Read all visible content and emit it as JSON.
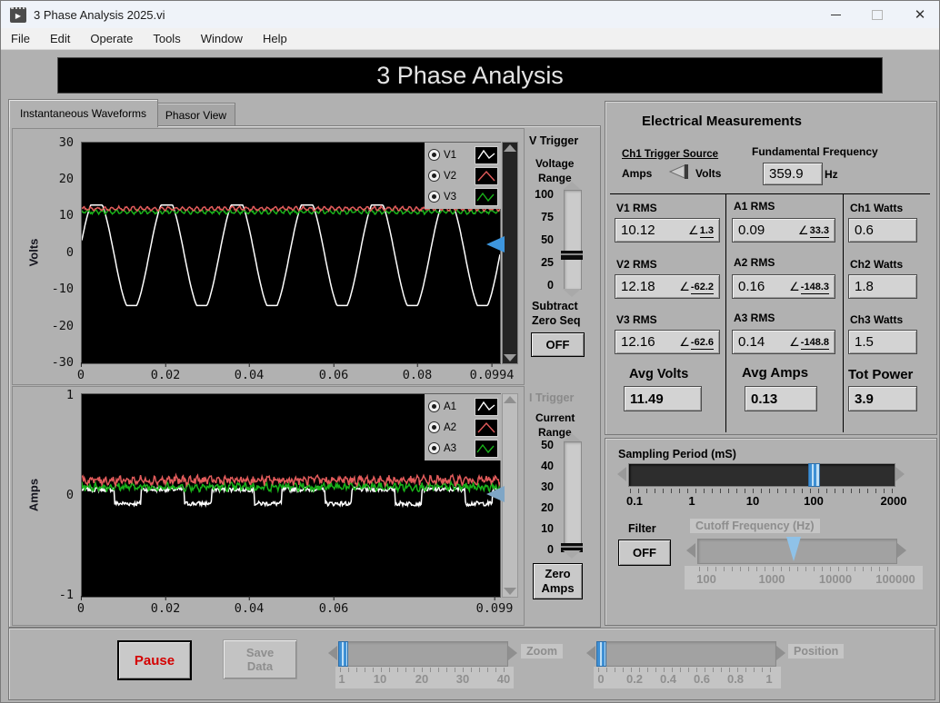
{
  "window": {
    "title": "3 Phase Analysis 2025.vi"
  },
  "menu": {
    "items": [
      "File",
      "Edit",
      "Operate",
      "Tools",
      "Window",
      "Help"
    ]
  },
  "banner": {
    "title": "3 Phase Analysis"
  },
  "tabs": [
    {
      "label": "Instantaneous Waveforms",
      "active": true
    },
    {
      "label": "Phasor View",
      "active": false
    }
  ],
  "v_trigger": {
    "title": "V Trigger",
    "range_line1": "Voltage",
    "range_line2": "Range",
    "ticks": [
      "100",
      "75",
      "50",
      "25",
      "0"
    ],
    "range_value": 30,
    "subtract_line1": "Subtract",
    "subtract_line2": "Zero Seq",
    "off_button": "OFF"
  },
  "i_trigger": {
    "title": "I Trigger",
    "range_line1": "Current",
    "range_line2": "Range",
    "ticks": [
      "50",
      "40",
      "30",
      "20",
      "10",
      "0"
    ],
    "range_value": 0,
    "zero_line1": "Zero",
    "zero_line2": "Amps"
  },
  "measurements": {
    "title": "Electrical Measurements",
    "angle_symbol": "∠",
    "trigger_source": {
      "label": "Ch1 Trigger Source",
      "left": "Amps",
      "right": "Volts"
    },
    "fundamental": {
      "label": "Fundamental Frequency",
      "value": "359.9",
      "unit": "Hz"
    },
    "volts": {
      "rows": [
        {
          "label": "V1 RMS",
          "value": "10.12",
          "angle": "1.3"
        },
        {
          "label": "V2 RMS",
          "value": "12.18",
          "angle": "-62.2"
        },
        {
          "label": "V3 RMS",
          "value": "12.16",
          "angle": "-62.6"
        }
      ],
      "avg_label": "Avg Volts",
      "avg_value": "11.49"
    },
    "amps": {
      "rows": [
        {
          "label": "A1 RMS",
          "value": "0.09",
          "angle": "33.3"
        },
        {
          "label": "A2 RMS",
          "value": "0.16",
          "angle": "-148.3"
        },
        {
          "label": "A3 RMS",
          "value": "0.14",
          "angle": "-148.8"
        }
      ],
      "avg_label": "Avg Amps",
      "avg_value": "0.13"
    },
    "watts": {
      "rows": [
        {
          "label": "Ch1 Watts",
          "value": "0.6"
        },
        {
          "label": "Ch2 Watts",
          "value": "1.8"
        },
        {
          "label": "Ch3 Watts",
          "value": "1.5"
        }
      ],
      "total_label": "Tot Power",
      "total_value": "3.9"
    }
  },
  "sampling": {
    "label": "Sampling Period (mS)",
    "ticks": [
      "0.1",
      "1",
      "10",
      "100",
      "2000"
    ],
    "value_ms": 100
  },
  "filter": {
    "label": "Filter",
    "button": "OFF",
    "cutoff_label": "Cutoff Frequency (Hz)",
    "cutoff_ticks": [
      "100",
      "1000",
      "10000",
      "100000"
    ],
    "cutoff_value_hz": 3000,
    "enabled": false
  },
  "footer": {
    "pause": "Pause",
    "save_line1": "Save",
    "save_line2": "Data",
    "zoom_label": "Zoom",
    "zoom_ticks": [
      "1",
      "10",
      "20",
      "30",
      "40"
    ],
    "zoom_value": 1,
    "position_label": "Position",
    "position_ticks": [
      "0",
      "0.2",
      "0.4",
      "0.6",
      "0.8",
      "1"
    ],
    "position_value": 0
  },
  "colors": {
    "accent_blue": "#3d96de",
    "pause_red": "#d40000",
    "panel_grey": "#b1b1b1"
  },
  "chart_data": [
    {
      "type": "line",
      "name": "volts-waveform-graph",
      "ylabel": "Volts",
      "xlim": [
        0,
        0.0994
      ],
      "ylim": [
        -30,
        30
      ],
      "x_ticks": [
        "0",
        "0.02",
        "0.04",
        "0.06",
        "0.08",
        "0.0994"
      ],
      "y_ticks": [
        "30",
        "20",
        "10",
        "0",
        "-10",
        "-20",
        "-30"
      ],
      "plot_bg": "#000000",
      "grid": false,
      "trigger_level": 2,
      "legend": [
        {
          "label": "V1",
          "color": "#ffffff"
        },
        {
          "label": "V2",
          "color": "#e25b5b"
        },
        {
          "label": "V3",
          "color": "#19b219"
        }
      ],
      "series": [
        {
          "name": "V1",
          "color": "#ffffff",
          "gen": {
            "base": -0.4,
            "amp": 15.5,
            "cycles": 5.96,
            "phase": 0.25,
            "noise": 0,
            "clip_max": 13,
            "clip_min": -14.3
          }
        },
        {
          "name": "V3",
          "color": "#19b219",
          "gen": {
            "base": 11.2,
            "amp": 0.45,
            "cycles": 59,
            "phase": 2.4,
            "noise": 0.25
          }
        },
        {
          "name": "V2",
          "color": "#e25b5b",
          "gen": {
            "base": 12.05,
            "amp": 0.45,
            "cycles": 59,
            "phase": 0,
            "noise": 0.25
          }
        }
      ]
    },
    {
      "type": "line",
      "name": "amps-waveform-graph",
      "ylabel": "Amps",
      "xlim": [
        0,
        0.099
      ],
      "ylim": [
        -1,
        1
      ],
      "x_ticks": [
        "0",
        "0.02",
        "0.04",
        "0.06",
        "0.099"
      ],
      "y_ticks": [
        "1",
        "0",
        "-1"
      ],
      "plot_bg": "#000000",
      "grid": false,
      "trigger_level": 0,
      "legend": [
        {
          "label": "A1",
          "color": "#ffffff"
        },
        {
          "label": "A2",
          "color": "#e25b5b"
        },
        {
          "label": "A3",
          "color": "#19b219"
        }
      ],
      "series": [
        {
          "name": "A1",
          "color": "#ffffff",
          "gen": {
            "base": -0.01,
            "amp": 0.07,
            "cycles": 5.96,
            "phase": 0.6,
            "noise": 0.022,
            "square": true,
            "duty": -0.35
          }
        },
        {
          "name": "A3",
          "color": "#19b219",
          "gen": {
            "base": 0.085,
            "amp": 0.02,
            "cycles": 59,
            "phase": 1.2,
            "noise": 0.03
          }
        },
        {
          "name": "A2",
          "color": "#e25b5b",
          "gen": {
            "base": 0.15,
            "amp": 0.02,
            "cycles": 59,
            "phase": 0,
            "noise": 0.035
          }
        }
      ]
    }
  ]
}
